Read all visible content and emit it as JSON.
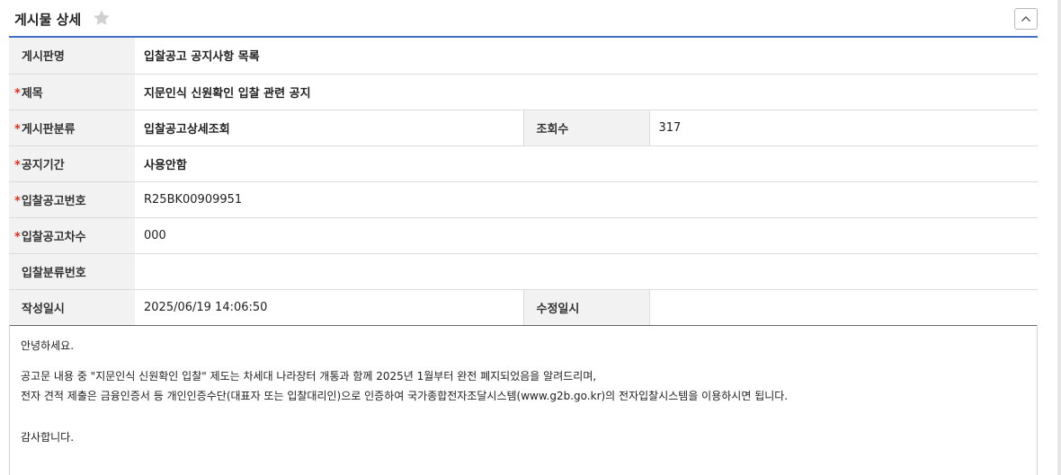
{
  "header": {
    "title": "게시물 상세",
    "star_icon": "star-icon",
    "collapse_icon": "chevron-up-icon"
  },
  "colors": {
    "accent_line": "#3f6fc6",
    "required_mark": "#e0301e",
    "label_bg": "#f2f2f2"
  },
  "fields": {
    "board_name": {
      "label": "게시판명",
      "value": "입찰공고 공지사항 목록"
    },
    "subject": {
      "label": "제목",
      "value": "지문인식 신원확인 입찰 관련 공지"
    },
    "category": {
      "label": "게시판분류",
      "value": "입찰공고상세조회"
    },
    "views": {
      "label": "조회수",
      "value": "317"
    },
    "period": {
      "label": "공지기간",
      "value": "사용안함"
    },
    "bid_no": {
      "label": "입찰공고번호",
      "value": "R25BK00909951"
    },
    "bid_seq": {
      "label": "입찰공고차수",
      "value": "000"
    },
    "bid_class_no": {
      "label": "입찰분류번호",
      "value": ""
    },
    "created": {
      "label": "작성일시",
      "value": "2025/06/19 14:06:50"
    },
    "modified": {
      "label": "수정일시",
      "value": ""
    }
  },
  "required_mark": "*",
  "content": {
    "greeting": "안녕하세요.",
    "line1": "공고문 내용 중  \"지문인식 신원확인 입찰\" 제도는 차세대 나라장터 개통과 함께 2025년 1월부터 완전 폐지되었음을 알려드리며,",
    "line2": "전자 견적 제출은 금융인증서 등 개인인증수단(대표자 또는 입찰대리인)으로 인증하여 국가종합전자조달시스템(www.g2b.go.kr)의 전자입찰시스템을 이용하시면 됩니다.",
    "closing": "감사합니다."
  }
}
